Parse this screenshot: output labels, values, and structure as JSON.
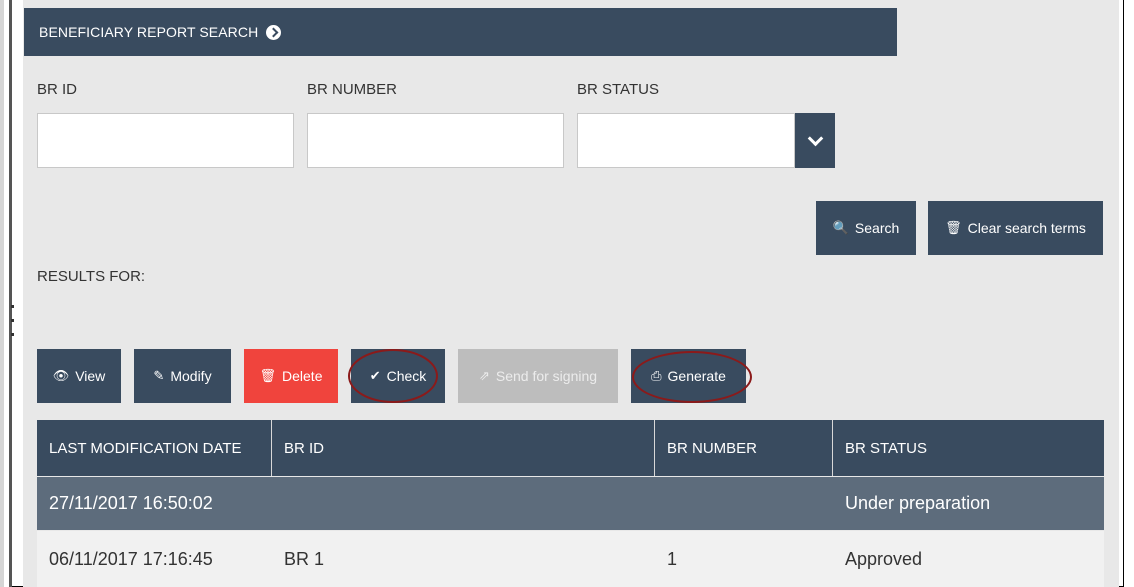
{
  "header": {
    "title": "BENEFICIARY REPORT SEARCH",
    "icon": "arrow-circle-right-icon"
  },
  "filters": {
    "br_id_label": "BR ID",
    "br_number_label": "BR NUMBER",
    "br_status_label": "BR STATUS",
    "br_id_value": "",
    "br_number_value": "",
    "br_status_value": ""
  },
  "search_buttons": {
    "search_label": "Search",
    "clear_label": "Clear search terms"
  },
  "results": {
    "label": "RESULTS FOR:"
  },
  "actions": {
    "view": "View",
    "modify": "Modify",
    "delete": "Delete",
    "check": "Check",
    "send": "Send for signing",
    "generate": "Generate"
  },
  "icons": {
    "view": "👁",
    "modify": "✎",
    "delete": "🗑",
    "check": "✔",
    "send": "⇗",
    "generate": "⎙",
    "search": "🔍",
    "clear": "🗑"
  },
  "table": {
    "columns": [
      "LAST MODIFICATION DATE",
      "BR ID",
      "BR NUMBER",
      "BR STATUS"
    ],
    "rows": [
      {
        "date": "27/11/2017 16:50:02",
        "br_id": "",
        "br_number": "",
        "status": "Under preparation"
      },
      {
        "date": "06/11/2017 17:16:45",
        "br_id": "BR 1",
        "br_number": "1",
        "status": "Approved"
      }
    ]
  },
  "colors": {
    "primary": "#394b5f",
    "danger": "#f0443d",
    "disabled": "#bdbdbd",
    "highlight_ellipse": "#8b1a1a"
  }
}
